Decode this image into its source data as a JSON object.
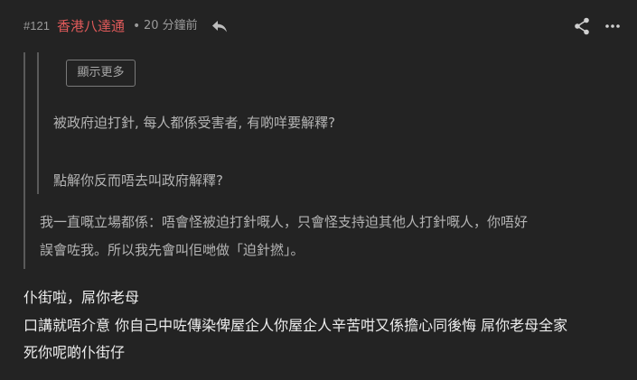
{
  "header": {
    "post_number": "#121",
    "username": "香港八達通",
    "separator": "•",
    "timestamp": "20 分鐘前",
    "icons": [
      "reply-icon",
      "share-icon",
      "more-icon"
    ]
  },
  "quote": {
    "nested": {
      "show_more_label": "顯示更多",
      "lines": [
        "被政府迫打針, 每人都係受害者, 有啲咩要解釋?",
        "點解你反而唔去叫政府解釋?"
      ]
    },
    "lines": [
      "我一直嘅立場都係：唔會怪被迫打針嘅人，只會怪支持迫其他人打針嘅人，你唔好",
      "誤會咗我。所以我先會叫佢哋做「迫針撚」。"
    ]
  },
  "reply": {
    "lines": [
      "仆街啦，屌你老母",
      "口講就唔介意 你自己中咗傳染俾屋企人你屋企人辛苦咁又係擔心同後悔 屌你老母全家",
      "死你呢啲仆街仔"
    ]
  },
  "colors": {
    "background": "#232323",
    "username": "#e05a5a",
    "meta": "#9a9a9a",
    "quote_text": "#b4b4b4",
    "body_text": "#ececec",
    "quote_bar": "#5a5a5a"
  }
}
